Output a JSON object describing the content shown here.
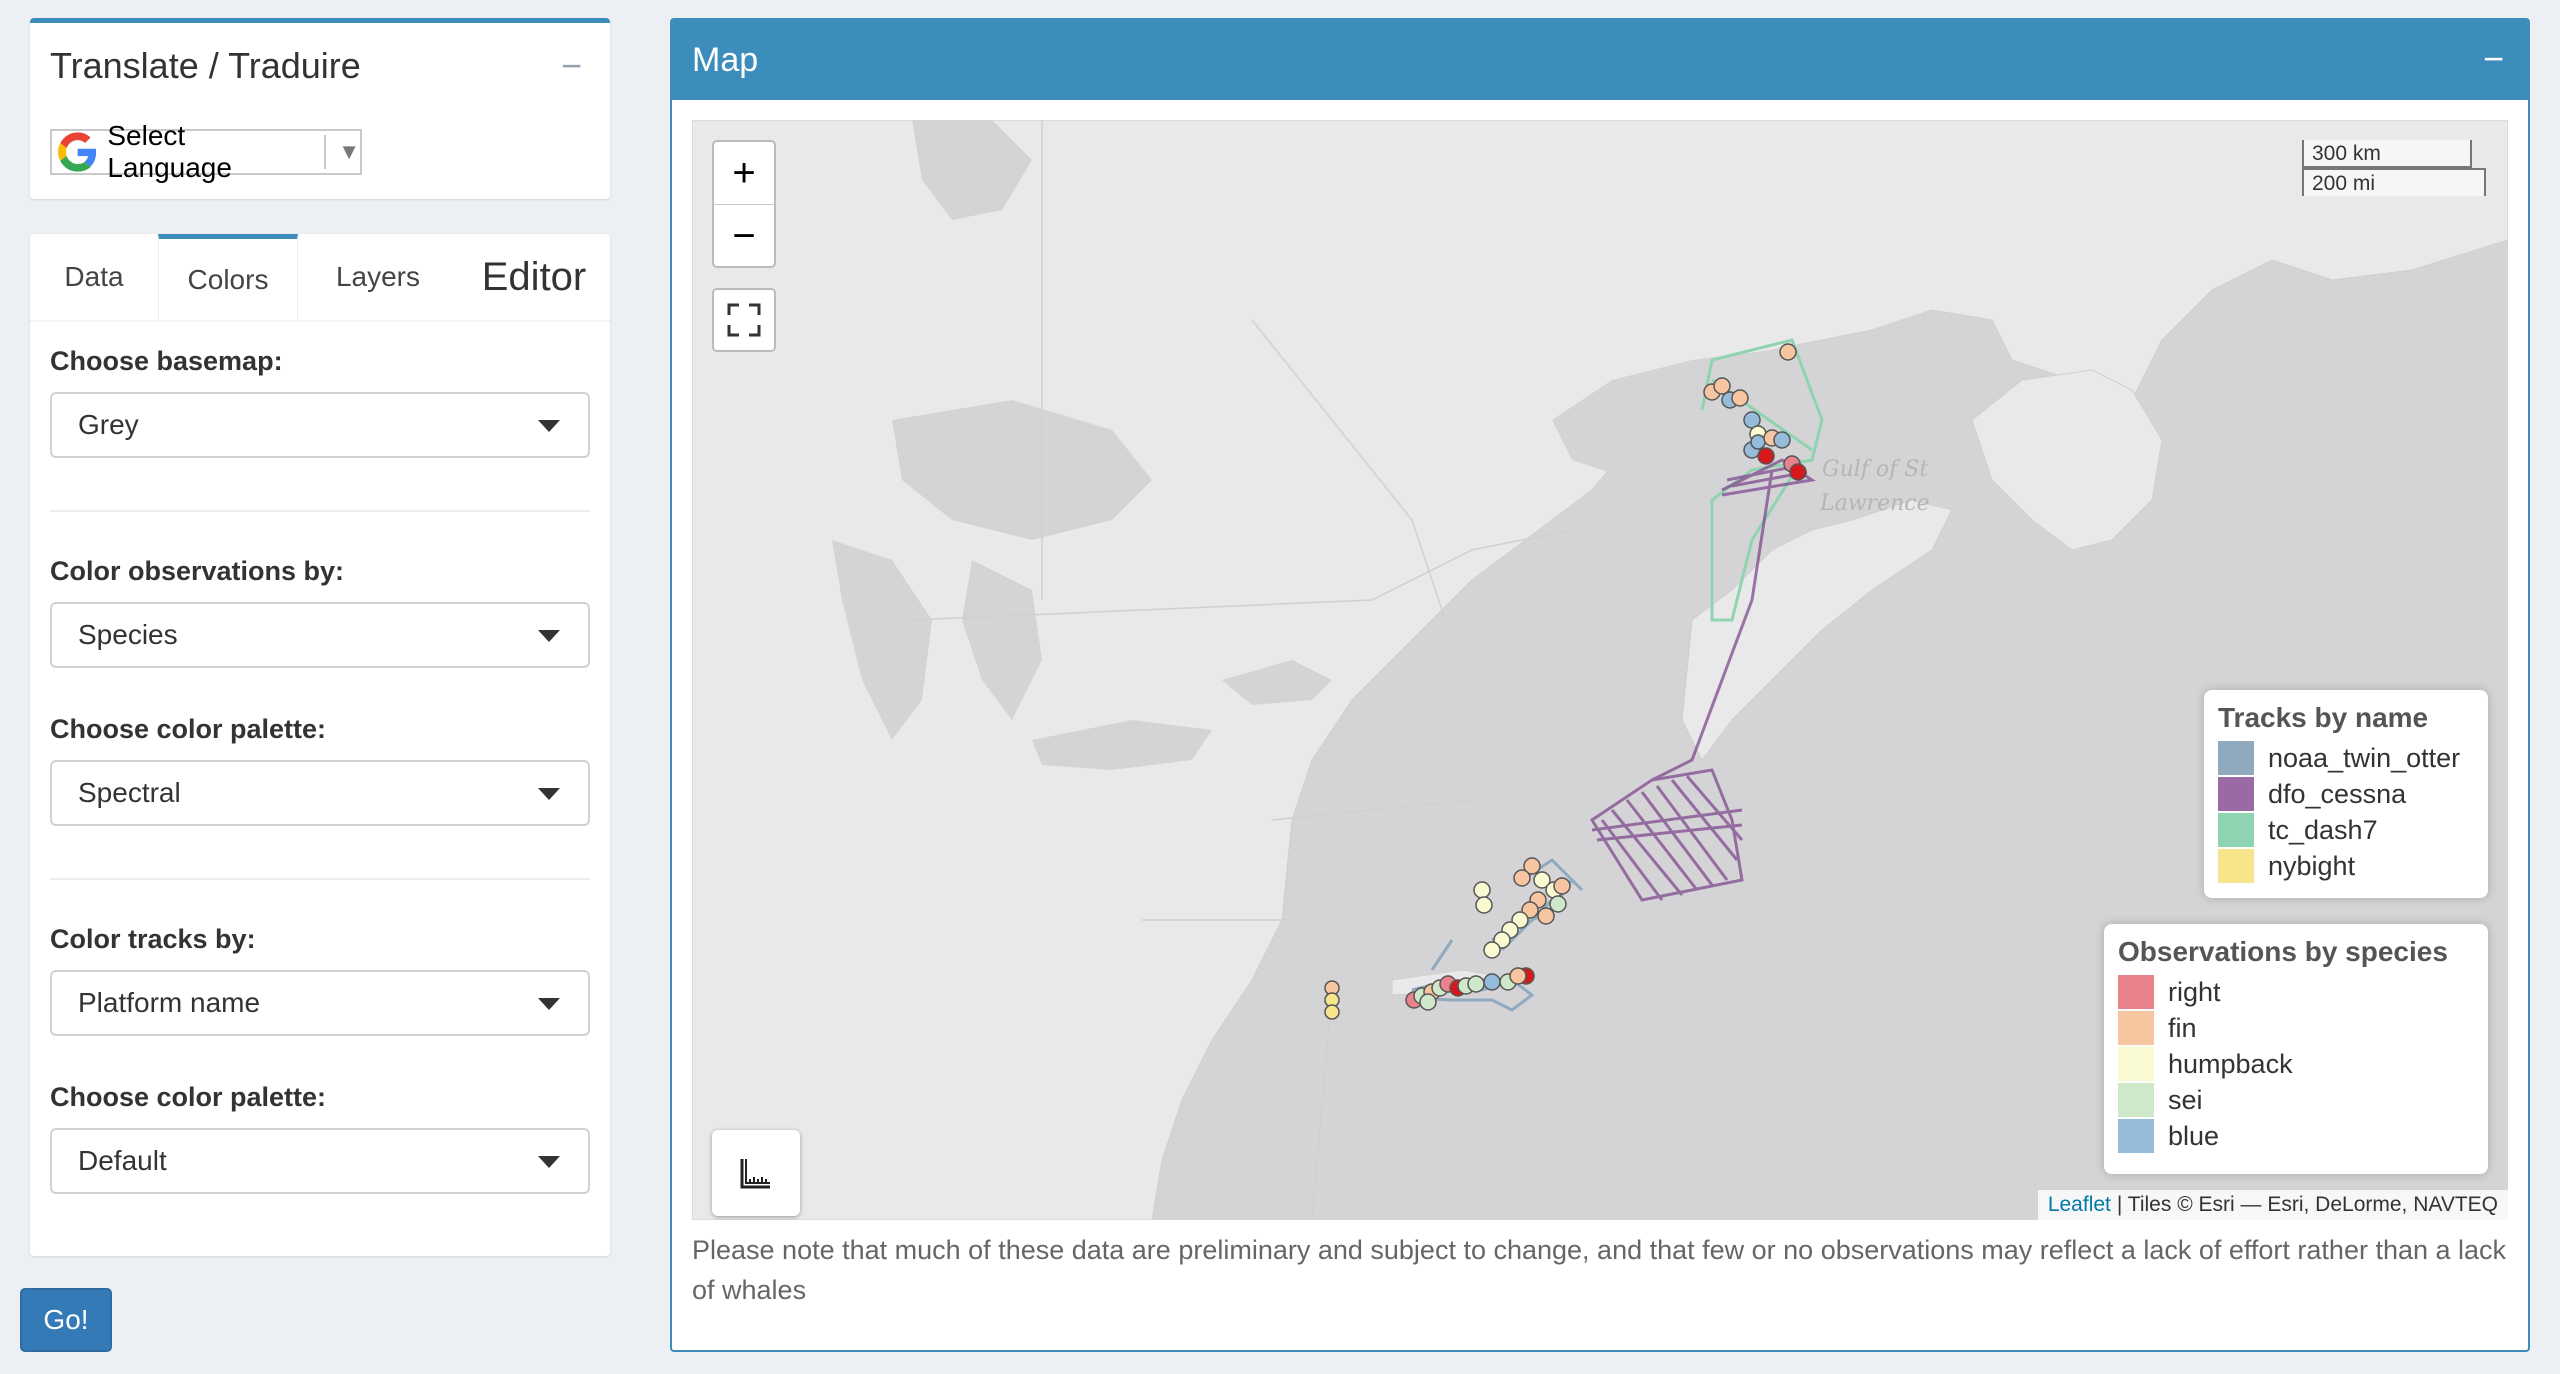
{
  "translate": {
    "title": "Translate / Traduire",
    "collapse": "−",
    "language_select": "Select Language",
    "language_arrow": "▼"
  },
  "tabs": [
    {
      "label": "Data"
    },
    {
      "label": "Colors",
      "active": true
    },
    {
      "label": "Layers"
    },
    {
      "label": "Editor"
    }
  ],
  "controls": {
    "basemap_label": "Choose basemap:",
    "basemap_value": "Grey",
    "color_obs_label": "Color observations by:",
    "color_obs_value": "Species",
    "obs_palette_label": "Choose color palette:",
    "obs_palette_value": "Spectral",
    "color_tracks_label": "Color tracks by:",
    "color_tracks_value": "Platform name",
    "tracks_palette_label": "Choose color palette:",
    "tracks_palette_value": "Default"
  },
  "go_button": "Go!",
  "map_box": {
    "title": "Map",
    "minimize": "−"
  },
  "map": {
    "zoom_in": "+",
    "zoom_out": "−",
    "scale_km": "300 km",
    "scale_mi": "200 mi",
    "gulf_label_1": "Gulf of St",
    "gulf_label_2": "Lawrence",
    "attribution_link": "Leaflet",
    "attribution_text": "| Tiles © Esri — Esri, DeLorme, NAVTEQ"
  },
  "legend_tracks": {
    "title": "Tracks by name",
    "items": [
      {
        "label": "noaa_twin_otter",
        "color": "#8fa9bf"
      },
      {
        "label": "dfo_cessna",
        "color": "#9b6aa4"
      },
      {
        "label": "tc_dash7",
        "color": "#8fd4b0"
      },
      {
        "label": "nybight",
        "color": "#f6e58a"
      }
    ]
  },
  "legend_obs": {
    "title": "Observations by species",
    "items": [
      {
        "label": "right",
        "color": "#e8838d"
      },
      {
        "label": "fin",
        "color": "#f7c6a1"
      },
      {
        "label": "humpback",
        "color": "#fafad2"
      },
      {
        "label": "sei",
        "color": "#cfe8c9"
      },
      {
        "label": "blue",
        "color": "#95bcda"
      }
    ]
  },
  "note": "Please note that much of these data are preliminary and subject to change, and that few or no observations may reflect a lack of effort rather than a lack of whales"
}
